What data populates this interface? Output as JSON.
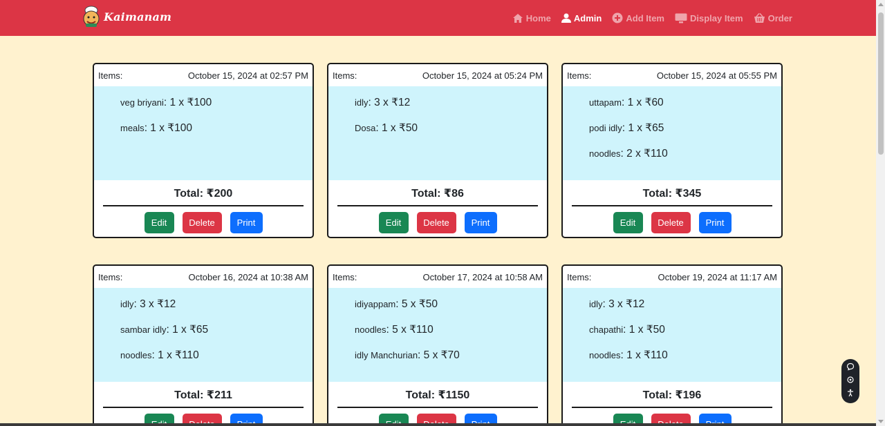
{
  "nav": {
    "brand": "Kaimanam",
    "links": [
      {
        "label": "Home",
        "icon": "home-icon"
      },
      {
        "label": "Admin",
        "icon": "user-icon"
      },
      {
        "label": "Add Item",
        "icon": "plus-circle-icon"
      },
      {
        "label": "Display Item",
        "icon": "monitor-icon"
      },
      {
        "label": "Order",
        "icon": "basket-icon"
      }
    ]
  },
  "orders": [
    {
      "items_label": "Items:",
      "date": "October 15, 2024 at 02:57 PM",
      "items": [
        {
          "name": "veg briyani",
          "qty": ": 1 x ₹100"
        },
        {
          "name": "meals",
          "qty": ": 1 x ₹100"
        }
      ],
      "total": "Total: ₹200",
      "edit": "Edit",
      "delete": "Delete",
      "print": "Print"
    },
    {
      "items_label": "Items:",
      "date": "October 15, 2024 at 05:24 PM",
      "items": [
        {
          "name": "idly",
          "qty": ": 3 x ₹12"
        },
        {
          "name": "Dosa",
          "qty": ": 1 x ₹50"
        }
      ],
      "total": "Total: ₹86",
      "edit": "Edit",
      "delete": "Delete",
      "print": "Print"
    },
    {
      "items_label": "Items:",
      "date": "October 15, 2024 at 05:55 PM",
      "items": [
        {
          "name": "uttapam",
          "qty": ": 1 x ₹60"
        },
        {
          "name": "podi idly",
          "qty": ": 1 x ₹65"
        },
        {
          "name": "noodles",
          "qty": ": 2 x ₹110"
        }
      ],
      "total": "Total: ₹345",
      "edit": "Edit",
      "delete": "Delete",
      "print": "Print"
    },
    {
      "items_label": "Items:",
      "date": "October 16, 2024 at 10:38 AM",
      "items": [
        {
          "name": "idly",
          "qty": ": 3 x ₹12"
        },
        {
          "name": "sambar idly",
          "qty": ": 1 x ₹65"
        },
        {
          "name": "noodles",
          "qty": ": 1 x ₹110"
        }
      ],
      "total": "Total: ₹211",
      "edit": "Edit",
      "delete": "Delete",
      "print": "Print"
    },
    {
      "items_label": "Items:",
      "date": "October 17, 2024 at 10:58 AM",
      "items": [
        {
          "name": "idiyappam",
          "qty": ": 5 x ₹50"
        },
        {
          "name": "noodles",
          "qty": ": 5 x ₹110"
        },
        {
          "name": "idly Manchurian",
          "qty": ": 5 x ₹70"
        }
      ],
      "total": "Total: ₹1150",
      "edit": "Edit",
      "delete": "Delete",
      "print": "Print"
    },
    {
      "items_label": "Items:",
      "date": "October 19, 2024 at 11:17 AM",
      "items": [
        {
          "name": "idly",
          "qty": ": 3 x ₹12"
        },
        {
          "name": "chapathi",
          "qty": ": 1 x ₹50"
        },
        {
          "name": "noodles",
          "qty": ": 1 x ₹110"
        }
      ],
      "total": "Total: ₹196",
      "edit": "Edit",
      "delete": "Delete",
      "print": "Print"
    }
  ],
  "colors": {
    "navbar": "#dc3545",
    "page_bg": "#fff2cf",
    "items_bg": "#cff4fc",
    "edit": "#198754",
    "delete": "#dc3545",
    "print": "#0d6efd"
  }
}
